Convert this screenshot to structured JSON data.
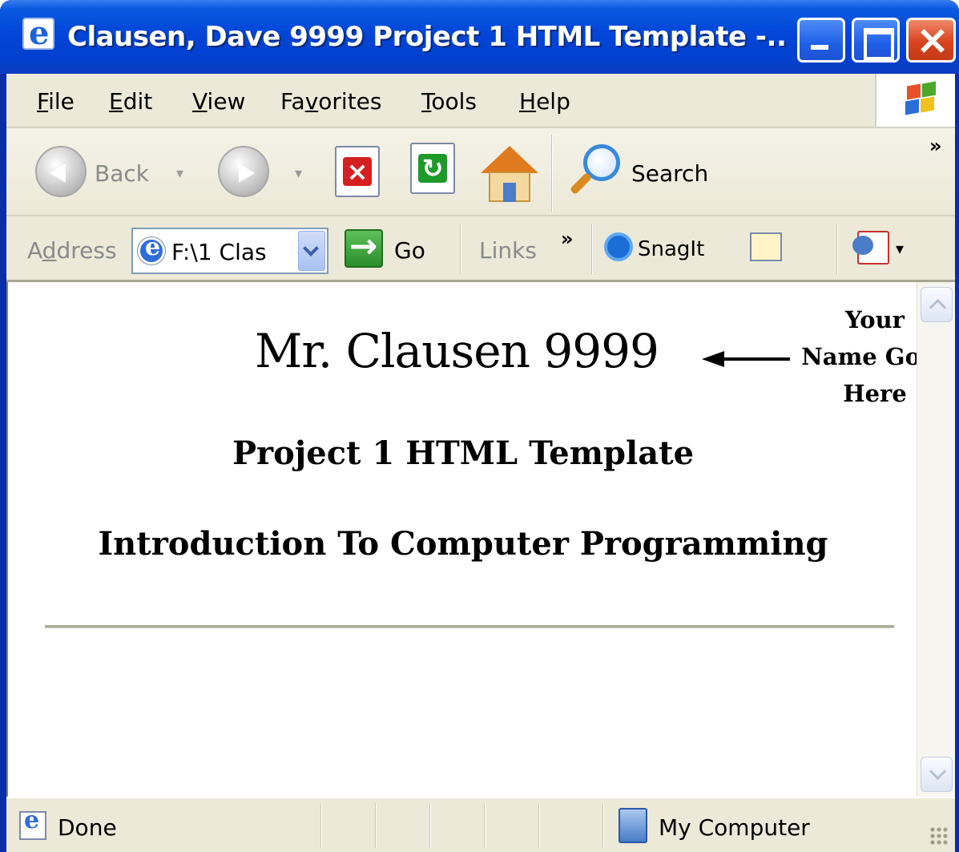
{
  "window": {
    "title": "Clausen, Dave 9999 Project 1 HTML Template -...",
    "colors": {
      "titlebar": "#0346d8",
      "chrome": "#ece9d8",
      "close": "#d9431f"
    }
  },
  "menu": {
    "items": [
      {
        "mnemonic": "F",
        "rest": "ile"
      },
      {
        "mnemonic": "E",
        "rest": "dit"
      },
      {
        "mnemonic": "V",
        "rest": "iew"
      },
      {
        "lead": "Fa",
        "mnemonic": "v",
        "rest": "orites"
      },
      {
        "mnemonic": "T",
        "rest": "ools"
      },
      {
        "mnemonic": "H",
        "rest": "elp"
      }
    ]
  },
  "toolbar": {
    "back_label": "Back",
    "search_label": "Search",
    "more_label": "»"
  },
  "address": {
    "label_lead": "A",
    "label_mnemonic": "d",
    "label_rest": "dress",
    "value": "F:\\1 Clas",
    "go_label": "Go",
    "links_label": "Links",
    "more_label": "»",
    "snagit_label": "SnagIt"
  },
  "page": {
    "name": "Mr. Clausen 9999",
    "annotation": [
      "Your",
      "Name Goes",
      "Here"
    ],
    "subtitle": "Project 1 HTML Template",
    "course": "Introduction To Computer Programming"
  },
  "status": {
    "text": "Done",
    "zone": "My Computer"
  }
}
